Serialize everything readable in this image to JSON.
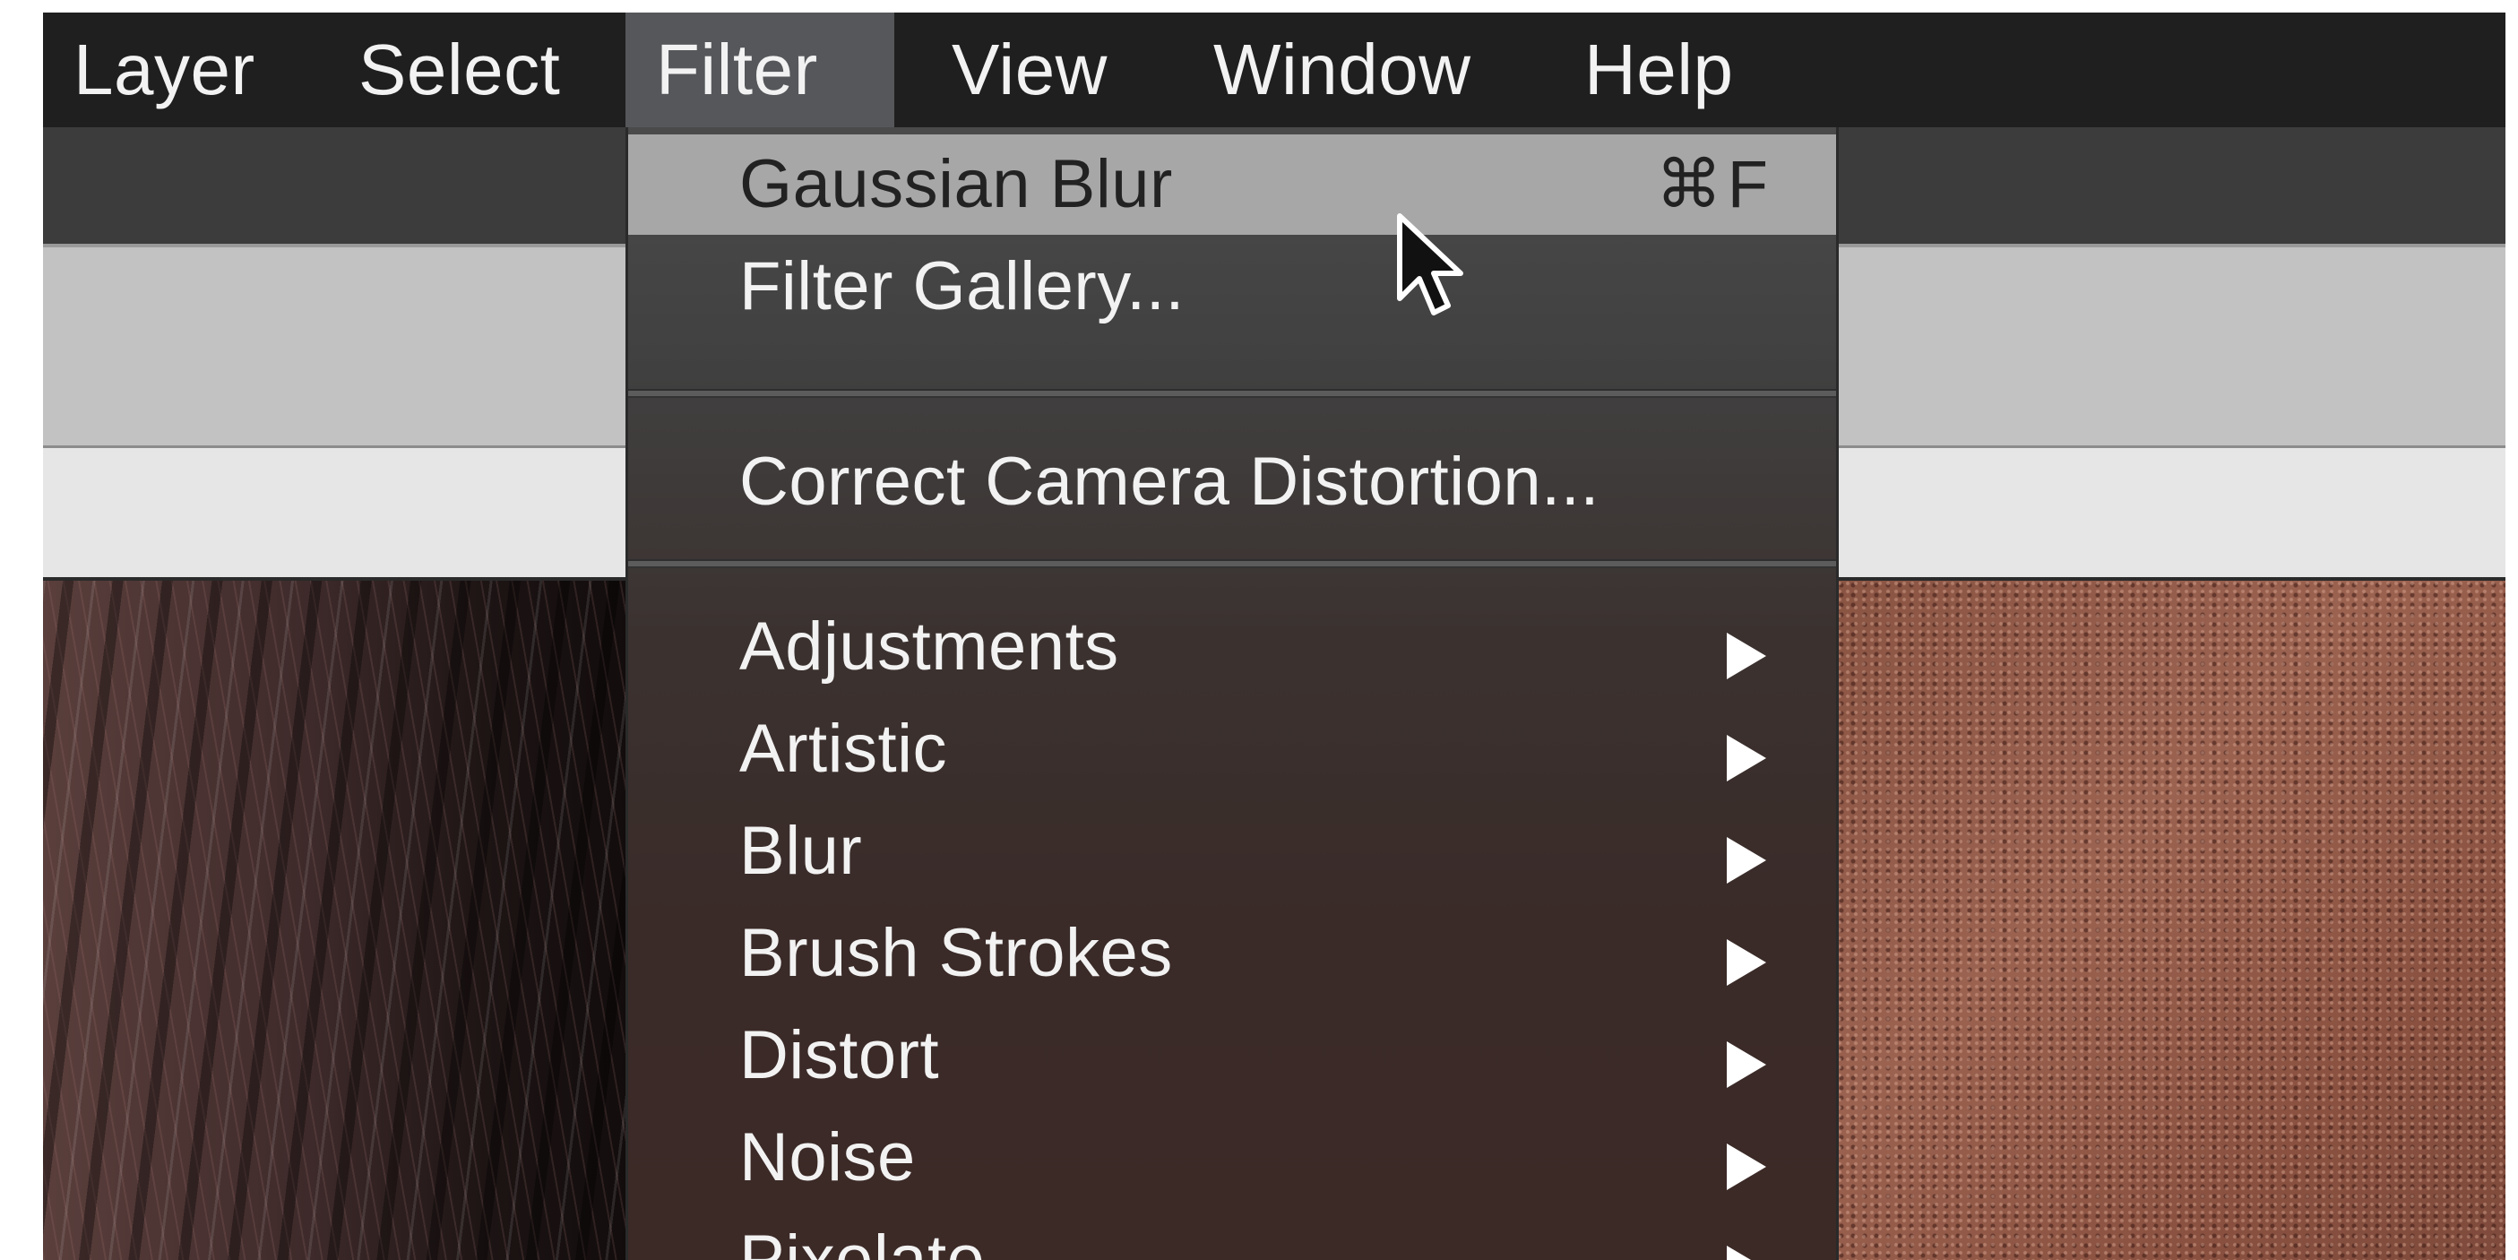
{
  "menubar": {
    "items": [
      {
        "label": "Layer"
      },
      {
        "label": "Select"
      },
      {
        "label": "Filter"
      },
      {
        "label": "View"
      },
      {
        "label": "Window"
      },
      {
        "label": "Help"
      }
    ],
    "active": "Filter"
  },
  "filter_menu": {
    "group1": [
      {
        "label": "Gaussian Blur",
        "shortcut": "⌘F",
        "highlighted": true
      },
      {
        "label": "Filter Gallery..."
      }
    ],
    "group2": [
      {
        "label": "Correct Camera Distortion..."
      }
    ],
    "group3": [
      {
        "label": "Adjustments",
        "submenu": true
      },
      {
        "label": "Artistic",
        "submenu": true
      },
      {
        "label": "Blur",
        "submenu": true
      },
      {
        "label": "Brush Strokes",
        "submenu": true
      },
      {
        "label": "Distort",
        "submenu": true
      },
      {
        "label": "Noise",
        "submenu": true
      },
      {
        "label": "Pixelate",
        "submenu": true
      }
    ]
  },
  "colors": {
    "menubar_bg": "#1f1f1f",
    "active_menu_bg": "#55575a",
    "highlight_bg": "#a7a7a7",
    "text": "#f2f2f2"
  },
  "icons": [
    "pointer-cursor-icon",
    "submenu-arrow-icon"
  ]
}
